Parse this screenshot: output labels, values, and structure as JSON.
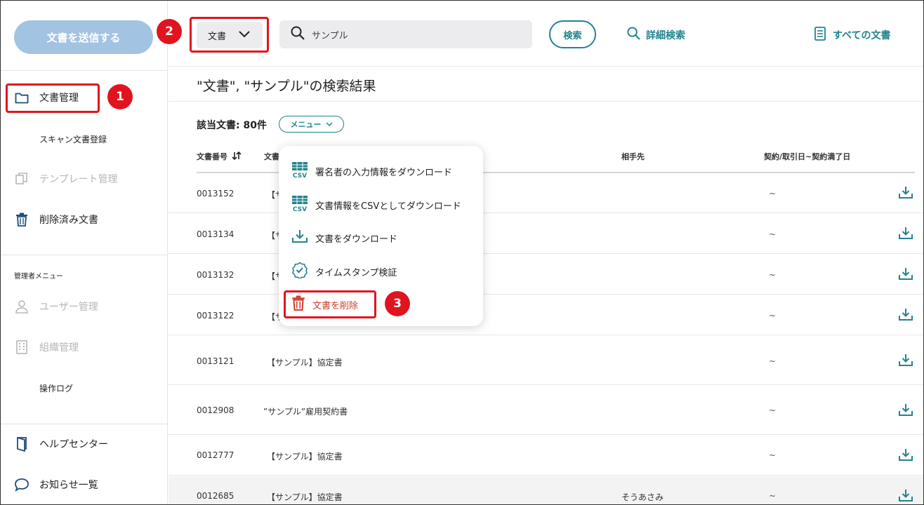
{
  "sidebar": {
    "send_button": "文書を送信する",
    "doc_management": "文書管理",
    "scan_register": "スキャン文書登録",
    "template_management": "テンプレート管理",
    "deleted_docs": "削除済み文書",
    "admin_menu": "管理者メニュー",
    "user_management": "ユーザー管理",
    "org_management": "組織管理",
    "operation_log": "操作ログ",
    "help_center": "ヘルプセンター",
    "notices": "お知らせ一覧"
  },
  "topbar": {
    "type_select": "文書",
    "search_value": "サンプル",
    "search_button": "検索",
    "advanced_search": "詳細検索",
    "all_documents": "すべての文書"
  },
  "results": {
    "title": "\"文書\", \"サンプル\"の検索結果",
    "count_label": "該当文書: 80件",
    "menu_label": "メニュー"
  },
  "table": {
    "headers": {
      "number": "文書番号",
      "title": "文書",
      "partner": "相手先",
      "date": "契約/取引日~契約満了日"
    },
    "rows": [
      {
        "number": "0013152",
        "title": "【サ",
        "partner": "",
        "date": "~"
      },
      {
        "number": "0013134",
        "title": "【サ",
        "partner": "",
        "date": "~"
      },
      {
        "number": "0013132",
        "title": "【サ",
        "partner": "",
        "date": "~"
      },
      {
        "number": "0013122",
        "title": "【サ",
        "partner": "",
        "date": "~"
      },
      {
        "number": "0013121",
        "title": "【サンプル】協定書",
        "partner": "",
        "date": "~"
      },
      {
        "number": "0012908",
        "title": "”サンプル”雇用契約書",
        "partner": "",
        "date": "~"
      },
      {
        "number": "0012777",
        "title": "【サンプル】協定書",
        "partner": "",
        "date": "~"
      },
      {
        "number": "0012685",
        "title": "【サンプル】協定書",
        "partner": "そうあさみ",
        "date": "~"
      }
    ]
  },
  "dropdown": {
    "items": [
      {
        "label": "署名者の入力情報をダウンロード",
        "icon": "csv-icon"
      },
      {
        "label": "文書情報をCSVとしてダウンロード",
        "icon": "csv-icon"
      },
      {
        "label": "文書をダウンロード",
        "icon": "download-icon"
      },
      {
        "label": "タイムスタンプ検証",
        "icon": "verified-check-icon"
      },
      {
        "label": "文書を削除",
        "icon": "trash-icon"
      }
    ]
  },
  "annotations": {
    "badge1": "1",
    "badge2": "2",
    "badge3": "3"
  },
  "colors": {
    "accent": "#22838d",
    "send_button": "#a3c3e3",
    "highlight": "#e0141e",
    "danger": "#d23a2a"
  }
}
